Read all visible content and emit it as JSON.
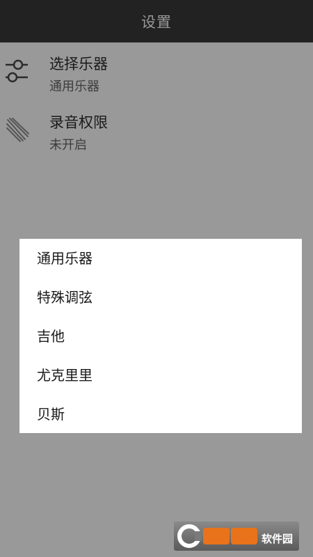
{
  "header": {
    "title": "设置"
  },
  "settings": [
    {
      "title": "选择乐器",
      "value": "通用乐器",
      "icon": "sliders-icon"
    },
    {
      "title": "录音权限",
      "value": "未开启",
      "icon": "record-permission-icon"
    }
  ],
  "dialog": {
    "options": [
      "通用乐器",
      "特殊调弦",
      "吉他",
      "尤克里里",
      "贝斯"
    ]
  },
  "watermark": {
    "brand": "软件园",
    "logo": "西西"
  },
  "colors": {
    "background": "#999999",
    "header": "#222222",
    "dialog": "#ffffff"
  }
}
